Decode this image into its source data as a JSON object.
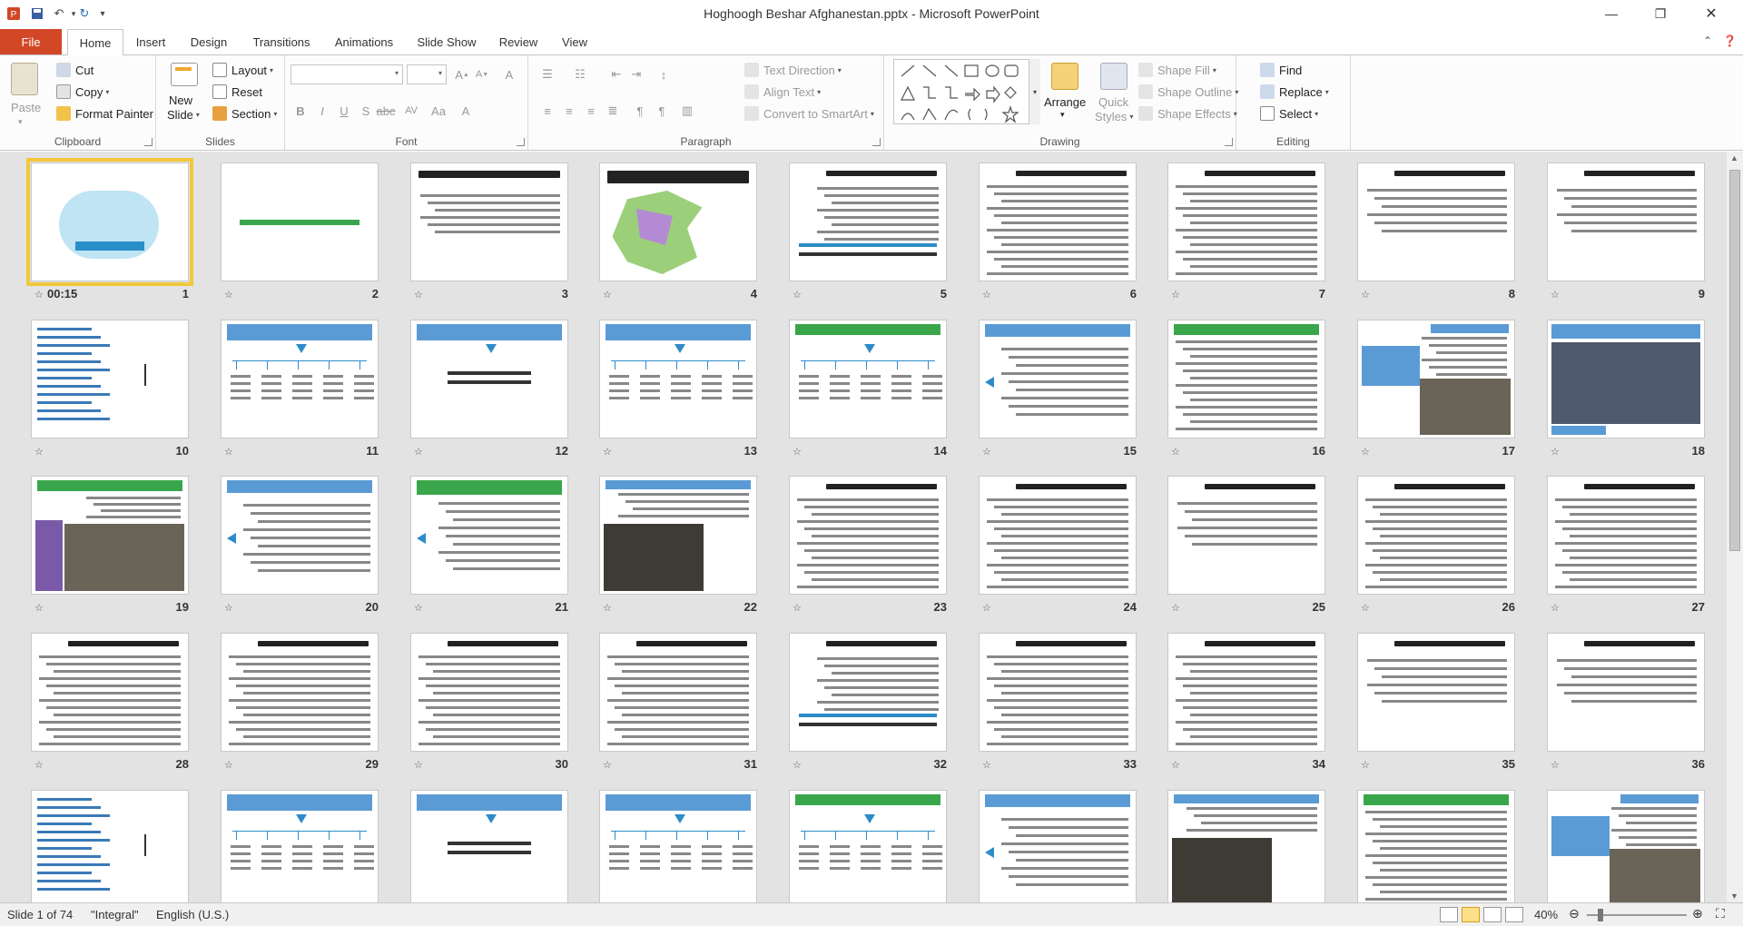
{
  "window": {
    "title": "Hoghoogh Beshar Afghanestan.pptx - Microsoft PowerPoint"
  },
  "qat": [
    "powerpoint-logo-icon",
    "save-icon",
    "undo-icon",
    "redo-icon",
    "customize-icon"
  ],
  "tabs": {
    "file": "File",
    "items": [
      "Home",
      "Insert",
      "Design",
      "Transitions",
      "Animations",
      "Slide Show",
      "Review",
      "View"
    ],
    "active": "Home"
  },
  "ribbon": {
    "clipboard": {
      "label": "Clipboard",
      "paste": "Paste",
      "cut": "Cut",
      "copy": "Copy",
      "format_painter": "Format Painter"
    },
    "slides": {
      "label": "Slides",
      "new_slide_1": "New",
      "new_slide_2": "Slide",
      "layout": "Layout",
      "reset": "Reset",
      "section": "Section"
    },
    "font": {
      "label": "Font",
      "font_name": "",
      "font_size": ""
    },
    "paragraph": {
      "label": "Paragraph",
      "text_direction": "Text Direction",
      "align_text": "Align Text",
      "convert_smartart": "Convert to SmartArt"
    },
    "drawing": {
      "label": "Drawing",
      "arrange": "Arrange",
      "quick_styles_1": "Quick",
      "quick_styles_2": "Styles",
      "shape_fill": "Shape Fill",
      "shape_outline": "Shape Outline",
      "shape_effects": "Shape Effects"
    },
    "editing": {
      "label": "Editing",
      "find": "Find",
      "replace": "Replace",
      "select": "Select"
    }
  },
  "slides": [
    {
      "num": "1",
      "time": "00:15",
      "kind": "cover"
    },
    {
      "num": "2",
      "kind": "title-green"
    },
    {
      "num": "3",
      "kind": "text-title"
    },
    {
      "num": "4",
      "kind": "map"
    },
    {
      "num": "5",
      "kind": "text-list"
    },
    {
      "num": "6",
      "kind": "text"
    },
    {
      "num": "7",
      "kind": "text"
    },
    {
      "num": "8",
      "kind": "text-short"
    },
    {
      "num": "9",
      "kind": "text-short"
    },
    {
      "num": "10",
      "kind": "list-left"
    },
    {
      "num": "11",
      "kind": "org"
    },
    {
      "num": "12",
      "kind": "banner-text"
    },
    {
      "num": "13",
      "kind": "org"
    },
    {
      "num": "14",
      "kind": "org-green"
    },
    {
      "num": "15",
      "kind": "banner-arrow"
    },
    {
      "num": "16",
      "kind": "green-text"
    },
    {
      "num": "17",
      "kind": "photo-box"
    },
    {
      "num": "18",
      "kind": "photo-library"
    },
    {
      "num": "19",
      "kind": "green-photo"
    },
    {
      "num": "20",
      "kind": "banner-arrow"
    },
    {
      "num": "21",
      "kind": "green-arrow"
    },
    {
      "num": "22",
      "kind": "photo-hall"
    },
    {
      "num": "23",
      "kind": "text"
    },
    {
      "num": "24",
      "kind": "text"
    },
    {
      "num": "25",
      "kind": "text-short"
    },
    {
      "num": "26",
      "kind": "text"
    },
    {
      "num": "27",
      "kind": "text"
    },
    {
      "num": "28",
      "kind": "text"
    },
    {
      "num": "29",
      "kind": "text"
    },
    {
      "num": "30",
      "kind": "text"
    },
    {
      "num": "31",
      "kind": "text"
    },
    {
      "num": "32",
      "kind": "text-list"
    },
    {
      "num": "33",
      "kind": "text"
    },
    {
      "num": "34",
      "kind": "text"
    },
    {
      "num": "35",
      "kind": "text-short"
    },
    {
      "num": "36",
      "kind": "text-short"
    },
    {
      "num": "",
      "kind": "list-left"
    },
    {
      "num": "",
      "kind": "org"
    },
    {
      "num": "",
      "kind": "banner-text"
    },
    {
      "num": "",
      "kind": "org"
    },
    {
      "num": "",
      "kind": "org-green"
    },
    {
      "num": "",
      "kind": "banner-arrow"
    },
    {
      "num": "",
      "kind": "photo-hall"
    },
    {
      "num": "",
      "kind": "green-text"
    },
    {
      "num": "",
      "kind": "photo-box"
    }
  ],
  "status": {
    "slide": "Slide 1 of 74",
    "theme": "\"Integral\"",
    "language": "English (U.S.)",
    "zoom": "40%"
  },
  "colors": {
    "file_tab": "#d24726",
    "selection": "#f0c83a",
    "banner_blue": "#5b9bd5",
    "banner_green": "#3aa64c"
  }
}
